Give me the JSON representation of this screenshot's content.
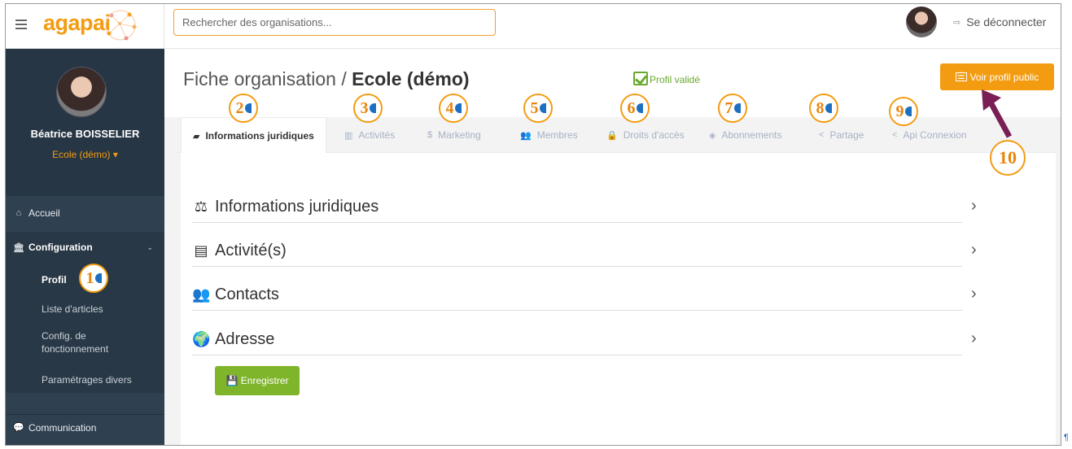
{
  "brand": {
    "logo_text": "agapai",
    "accent_color": "#f39c12"
  },
  "search": {
    "placeholder": "Rechercher des organisations..."
  },
  "header": {
    "logout_label": "Se déconnecter",
    "logout_icon": "sign-out-icon"
  },
  "sidebar": {
    "user_name": "Béatrice BOISSELIER",
    "org_selector": "Ecole (démo) ▾",
    "items": [
      {
        "label": "Accueil",
        "icon": "home-icon"
      },
      {
        "label": "Configuration",
        "icon": "bank-icon",
        "expanded": true,
        "children": [
          "Profil",
          "Liste d'articles",
          "Config. de fonctionnement",
          "Paramétrages divers"
        ]
      },
      {
        "label": "Communication",
        "icon": "comments-icon"
      }
    ]
  },
  "page": {
    "title_prefix": "Fiche organisation /",
    "title_name": "Ecole (démo)",
    "status": "Profil validé",
    "status_color": "#68a92d",
    "public_profile_button": "Voir profil public"
  },
  "tabs": [
    {
      "label": "Informations juridiques",
      "icon": "folder-open-icon",
      "active": true
    },
    {
      "label": "Activités",
      "icon": "bar-chart-icon"
    },
    {
      "label": "Marketing",
      "icon": "dollar-icon"
    },
    {
      "label": "Membres",
      "icon": "users-icon"
    },
    {
      "label": "Droits d'accès",
      "icon": "lock-icon"
    },
    {
      "label": "Abonnements",
      "icon": "tag-icon"
    },
    {
      "label": "Partage",
      "icon": "share-icon"
    },
    {
      "label": "Api Connexion",
      "icon": "share-icon"
    }
  ],
  "sections": [
    {
      "label": "Informations juridiques",
      "icon": "balance-scale-icon"
    },
    {
      "label": "Activité(s)",
      "icon": "id-card-icon"
    },
    {
      "label": "Contacts",
      "icon": "users-icon"
    },
    {
      "label": "Adresse",
      "icon": "globe-icon"
    }
  ],
  "save_button": "Enregistrer",
  "markers": [
    "1",
    "2",
    "3",
    "4",
    "5",
    "6",
    "7",
    "8",
    "9",
    "10"
  ]
}
